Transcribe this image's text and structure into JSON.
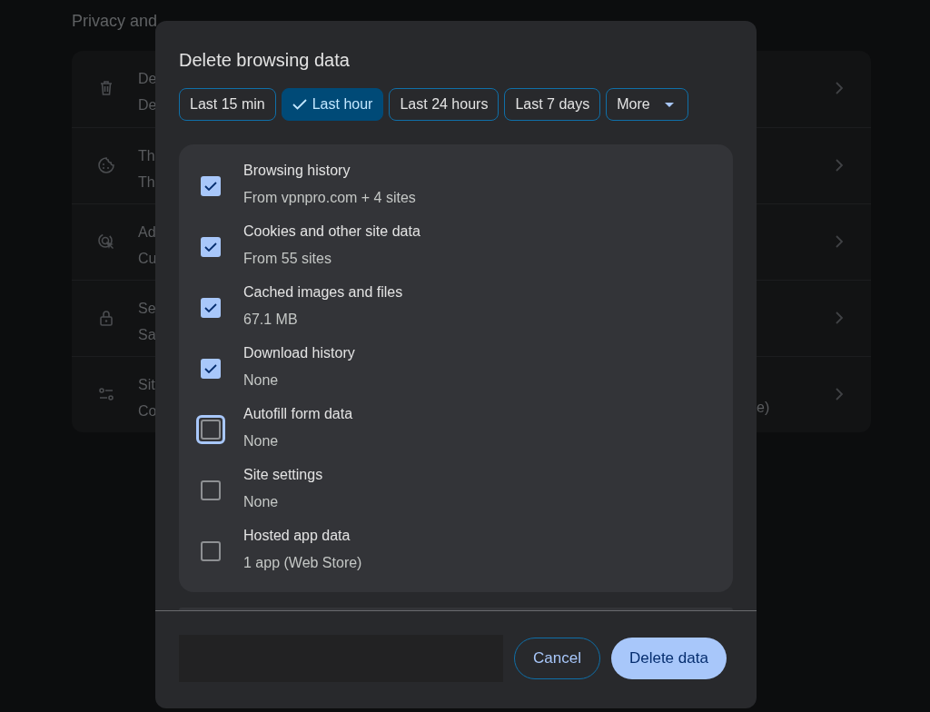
{
  "page": {
    "section_title": "Privacy and",
    "rows": [
      {
        "title": "De",
        "subtitle": "De"
      },
      {
        "title": "Th",
        "subtitle": "Th"
      },
      {
        "title": "Ad",
        "subtitle": "Cu"
      },
      {
        "title": "Se",
        "subtitle": "Sa"
      },
      {
        "title": "Sit",
        "subtitle": "Co",
        "tail": "e)"
      }
    ]
  },
  "dialog": {
    "title": "Delete browsing data",
    "time_ranges": [
      {
        "label": "Last 15 min",
        "selected": false
      },
      {
        "label": "Last hour",
        "selected": true
      },
      {
        "label": "Last 24 hours",
        "selected": false
      },
      {
        "label": "Last 7 days",
        "selected": false
      },
      {
        "label": "More",
        "selected": false,
        "kind": "dropdown"
      }
    ],
    "items": [
      {
        "label": "Browsing history",
        "detail": "From vpnpro.com + 4 sites",
        "checked": true,
        "focused": false
      },
      {
        "label": "Cookies and other site data",
        "detail": "From 55 sites",
        "checked": true,
        "focused": false
      },
      {
        "label": "Cached images and files",
        "detail": "67.1 MB",
        "checked": true,
        "focused": false
      },
      {
        "label": "Download history",
        "detail": "None",
        "checked": true,
        "focused": false
      },
      {
        "label": "Autofill form data",
        "detail": "None",
        "checked": false,
        "focused": true
      },
      {
        "label": "Site settings",
        "detail": "None",
        "checked": false,
        "focused": false
      },
      {
        "label": "Hosted app data",
        "detail": "1 app (Web Store)",
        "checked": false,
        "focused": false
      }
    ],
    "buttons": [
      {
        "label": "Cancel",
        "kind": "secondary"
      },
      {
        "label": "Delete data",
        "kind": "primary"
      }
    ]
  }
}
